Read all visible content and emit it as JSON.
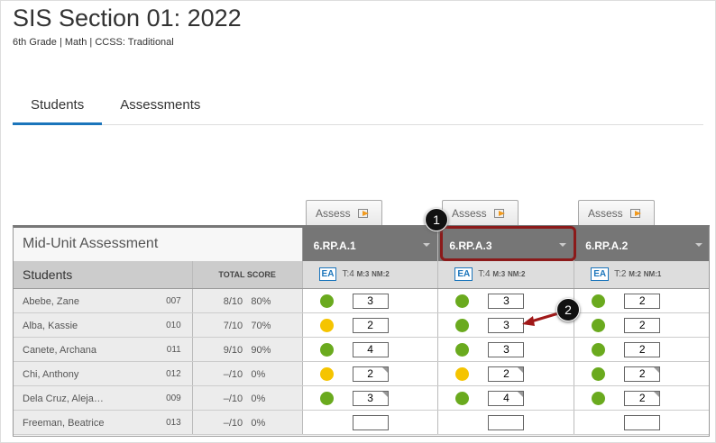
{
  "header": {
    "title": "SIS Section 01: 2022",
    "subtitle": "6th Grade  |  Math  |  CCSS: Traditional"
  },
  "tabs": [
    {
      "label": "Students"
    },
    {
      "label": "Assessments"
    }
  ],
  "assessment_title": "Mid-Unit Assessment",
  "assess_label": "Assess",
  "students_header": "Students",
  "total_header": "TOTAL SCORE",
  "standards": [
    {
      "code": "6.RP.A.1",
      "ea": "EA",
      "t": "T:4",
      "m": "M:3",
      "nm": "NM:2"
    },
    {
      "code": "6.RP.A.3",
      "ea": "EA",
      "t": "T:4",
      "m": "M:3",
      "nm": "NM:2"
    },
    {
      "code": "6.RP.A.2",
      "ea": "EA",
      "t": "T:2",
      "m": "M:2",
      "nm": "NM:1"
    }
  ],
  "colors": {
    "green": "#6aaa1e",
    "yellow": "#f5c400",
    "accent": "#1b75bb",
    "highlight": "#8b1a1a"
  },
  "students": [
    {
      "name": "Abebe, Zane",
      "id": "007",
      "score": "8/10",
      "pct": "80%",
      "cells": [
        {
          "s": "green",
          "v": "3",
          "c": false
        },
        {
          "s": "green",
          "v": "3",
          "c": false
        },
        {
          "s": "green",
          "v": "2",
          "c": false
        }
      ]
    },
    {
      "name": "Alba, Kassie",
      "id": "010",
      "score": "7/10",
      "pct": "70%",
      "cells": [
        {
          "s": "yellow",
          "v": "2",
          "c": false
        },
        {
          "s": "green",
          "v": "3",
          "c": false
        },
        {
          "s": "green",
          "v": "2",
          "c": false
        }
      ]
    },
    {
      "name": "Canete, Archana",
      "id": "011",
      "score": "9/10",
      "pct": "90%",
      "cells": [
        {
          "s": "green",
          "v": "4",
          "c": false
        },
        {
          "s": "green",
          "v": "3",
          "c": false
        },
        {
          "s": "green",
          "v": "2",
          "c": false
        }
      ]
    },
    {
      "name": "Chi, Anthony",
      "id": "012",
      "score": "–/10",
      "pct": "0%",
      "cells": [
        {
          "s": "yellow",
          "v": "2",
          "c": true
        },
        {
          "s": "yellow",
          "v": "2",
          "c": true
        },
        {
          "s": "green",
          "v": "2",
          "c": true
        }
      ]
    },
    {
      "name": "Dela Cruz, Aleja…",
      "id": "009",
      "score": "–/10",
      "pct": "0%",
      "cells": [
        {
          "s": "green",
          "v": "3",
          "c": true
        },
        {
          "s": "green",
          "v": "4",
          "c": true
        },
        {
          "s": "green",
          "v": "2",
          "c": true
        }
      ]
    },
    {
      "name": "Freeman, Beatrice",
      "id": "013",
      "score": "–/10",
      "pct": "0%",
      "cells": [
        {
          "s": "",
          "v": "",
          "c": false
        },
        {
          "s": "",
          "v": "",
          "c": false
        },
        {
          "s": "",
          "v": "",
          "c": false
        }
      ]
    }
  ],
  "callouts": [
    "1",
    "2"
  ]
}
